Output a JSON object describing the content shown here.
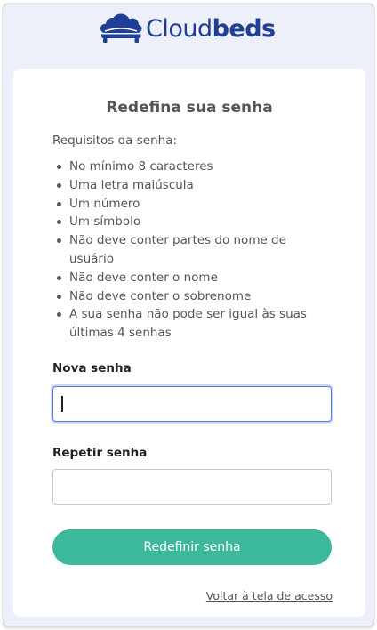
{
  "brand": {
    "name_light": "Cloud",
    "name_bold": "beds",
    "name_suffix": ".",
    "logo_icon": "cloud-bed-icon",
    "color": "#1f3f96"
  },
  "card": {
    "title": "Redefina sua senha",
    "requirements_title": "Requisitos da senha:",
    "requirements": [
      "No mínimo 8 caracteres",
      "Uma letra maiúscula",
      "Um número",
      "Um símbolo",
      "Não deve conter partes do nome de usuário",
      "Não deve conter o nome",
      "Não deve conter o sobrenome",
      "A sua senha não pode ser igual às suas últimas 4 senhas"
    ],
    "new_password": {
      "label": "Nova senha",
      "value": "",
      "placeholder": ""
    },
    "repeat_password": {
      "label": "Repetir senha",
      "value": "",
      "placeholder": ""
    },
    "submit_label": "Redefinir senha",
    "back_link": "Voltar à tela de acesso"
  },
  "colors": {
    "accent": "#3cb99b",
    "focus_border": "#5a7bd6",
    "background": "#eef0f9"
  }
}
